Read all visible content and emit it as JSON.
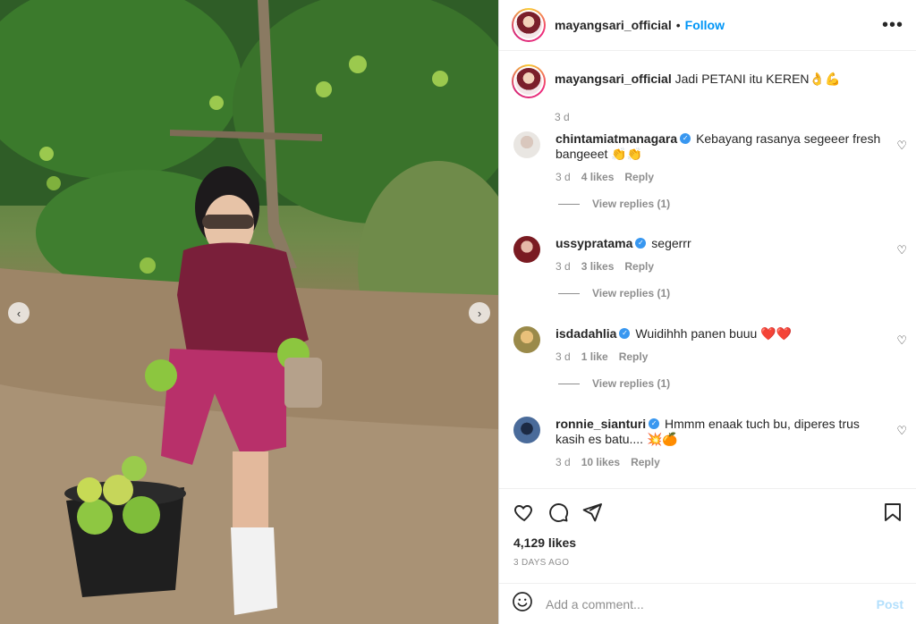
{
  "post": {
    "author": "mayangsari_official",
    "separator": "•",
    "follow_label": "Follow",
    "more_icon": "more-horizontal-icon",
    "caption": "Jadi PETANI itu KEREN👌💪",
    "caption_time": "3 d"
  },
  "photo": {
    "prev_icon": "chevron-left-icon",
    "next_icon": "chevron-right-icon"
  },
  "comments": [
    {
      "user": "chintamiatmanagara",
      "text": "Kebayang rasanya segeeer fresh bangeeet 👏👏",
      "time": "3 d",
      "likes": "4 likes",
      "reply": "Reply",
      "view_replies": "View replies (1)"
    },
    {
      "user": "ussypratama",
      "text": "segerrr",
      "time": "3 d",
      "likes": "3 likes",
      "reply": "Reply",
      "view_replies": "View replies (1)"
    },
    {
      "user": "isdadahlia",
      "text": "Wuidihhh panen buuu ❤️❤️",
      "time": "3 d",
      "likes": "1 like",
      "reply": "Reply",
      "view_replies": "View replies (1)"
    },
    {
      "user": "ronnie_sianturi",
      "text": "Hmmm enaak tuch bu, diperes trus kasih es batu.... 💥🍊",
      "time": "3 d",
      "likes": "10 likes",
      "reply": "Reply"
    }
  ],
  "actions": {
    "likes_count": "4,129 likes",
    "date": "3 DAYS AGO"
  },
  "add_comment": {
    "placeholder": "Add a comment...",
    "post_label": "Post"
  },
  "colors": {
    "accent": "#0095f6",
    "post_disabled": "#b2dffc",
    "verified": "#3897f0",
    "muted": "#8e8e8e"
  }
}
